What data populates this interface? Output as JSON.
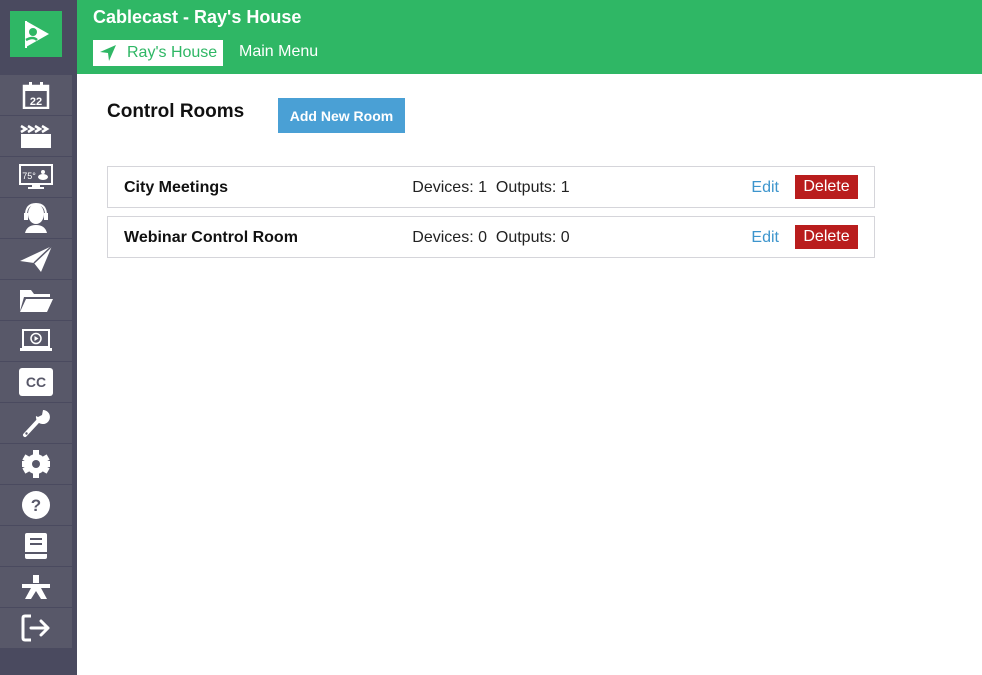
{
  "header": {
    "app_title": "Cablecast - Ray's House",
    "site_label": "Ray's House",
    "main_menu_label": "Main Menu",
    "brand_color": "#2fb765"
  },
  "sidebar": {
    "logo_icon": "cablecast-flag-logo-icon",
    "items": [
      {
        "icon": "calendar-icon",
        "label": "Schedule",
        "badge": "22"
      },
      {
        "icon": "clapperboard-icon",
        "label": "Shows"
      },
      {
        "icon": "digital-signage-icon",
        "label": "Digital Signage",
        "badge": "75°"
      },
      {
        "icon": "headset-icon",
        "label": "Live"
      },
      {
        "icon": "paper-plane-icon",
        "label": "Publish"
      },
      {
        "icon": "folder-open-icon",
        "label": "Files"
      },
      {
        "icon": "laptop-play-icon",
        "label": "VOD"
      },
      {
        "icon": "closed-captions-icon",
        "label": "Captions",
        "badge": "CC"
      },
      {
        "icon": "wrench-icon",
        "label": "Tools"
      },
      {
        "icon": "gear-icon",
        "label": "Settings"
      },
      {
        "icon": "help-icon",
        "label": "Help",
        "badge": "?"
      },
      {
        "icon": "book-icon",
        "label": "Documentation"
      },
      {
        "icon": "person-icon",
        "label": "Accessibility"
      },
      {
        "icon": "logout-icon",
        "label": "Log Out"
      }
    ]
  },
  "main": {
    "title": "Control Rooms",
    "add_button_label": "Add New Room",
    "rooms": [
      {
        "name": "City Meetings",
        "devices_label": "Devices: 1",
        "outputs_label": "Outputs: 1",
        "edit_label": "Edit",
        "delete_label": "Delete"
      },
      {
        "name": "Webinar Control Room",
        "devices_label": "Devices: 0",
        "outputs_label": "Outputs: 0",
        "edit_label": "Edit",
        "delete_label": "Delete"
      }
    ]
  }
}
